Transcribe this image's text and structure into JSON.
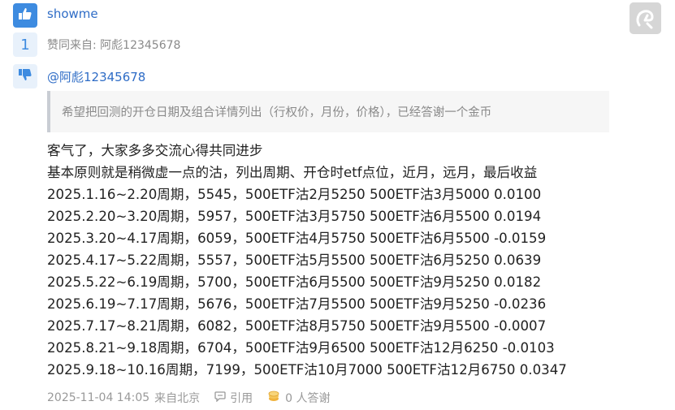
{
  "post": {
    "username": "showme",
    "like_count": "1",
    "agree_prefix": "赞同来自:",
    "agree_from": "阿彪12345678",
    "mention": "@阿彪12345678",
    "quote": "希望把回测的开仓日期及组合详情列出（行权价，月份，价格），已经答谢一个金币",
    "body_lines": [
      "客气了，大家多多交流心得共同进步",
      "基本原则就是稍微虚一点的沽，列出周期、开仓时etf点位，近月，远月，最后收益",
      "2025.1.16~2.20周期，5545，500ETF沽2月5250 500ETF沽3月5000 0.0100",
      "2025.2.20~3.20周期，5957，500ETF沽3月5750 500ETF沽6月5500 0.0194",
      "2025.3.20~4.17周期，6059，500ETF沽4月5750 500ETF沽6月5500 -0.0159",
      "2025.4.17~5.22周期，5557，500ETF沽5月5500 500ETF沽6月5250 0.0639",
      "2025.5.22~6.19周期，5700，500ETF沽6月5500 500ETF沽9月5250 0.0182",
      "2025.6.19~7.17周期，5676，500ETF沽7月5500 500ETF沽9月5250 -0.0236",
      "2025.7.17~8.21周期，6082，500ETF沽8月5750 500ETF沽9月5500 -0.0007",
      "2025.8.21~9.18周期，6704，500ETF沽9月6500 500ETF沽12月6250 -0.0103",
      "2025.9.18~10.16周期，7199，500ETF沽10月7000 500ETF沽12月6750 0.0347"
    ],
    "timestamp": "2025-11-04 14:05",
    "location": "来自北京",
    "quote_label": "引用",
    "thanks_label": "0 人答谢"
  },
  "icons": {
    "like": "thumbs-up-icon",
    "dislike": "thumbs-down-icon",
    "quote": "quote-bubble-icon",
    "coin": "coin-icon",
    "avatar": "avatar-placeholder"
  },
  "colors": {
    "accent": "#3d8be0",
    "link": "#2e6cc6",
    "muted": "#999999",
    "coin": "#f0b23c"
  }
}
